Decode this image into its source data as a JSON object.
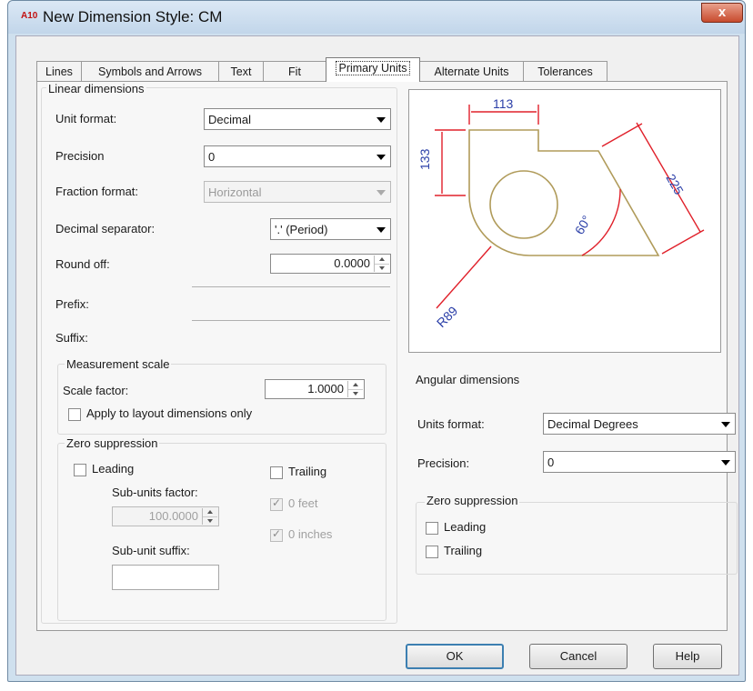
{
  "window": {
    "app_icon": "A10",
    "title": "New Dimension Style: CM",
    "close": "x"
  },
  "tabs": [
    {
      "label": "Lines"
    },
    {
      "label": "Symbols and Arrows"
    },
    {
      "label": "Text"
    },
    {
      "label": "Fit"
    },
    {
      "label": "Primary Units",
      "active": true
    },
    {
      "label": "Alternate Units"
    },
    {
      "label": "Tolerances"
    }
  ],
  "linear": {
    "heading": "Linear dimensions",
    "unit_format_label": "Unit format:",
    "unit_format_value": "Decimal",
    "precision_label": "Precision",
    "precision_value": "0",
    "fraction_format_label": "Fraction format:",
    "fraction_format_value": "Horizontal",
    "decimal_separator_label": "Decimal separator:",
    "decimal_separator_value": "'.' (Period)",
    "round_off_label": "Round off:",
    "round_off_value": "0.0000",
    "prefix_label": "Prefix:",
    "suffix_label": "Suffix:"
  },
  "measurement_scale": {
    "heading": "Measurement scale",
    "scale_factor_label": "Scale factor:",
    "scale_factor_value": "1.0000",
    "apply_layout_label": "Apply to layout dimensions only"
  },
  "zero_suppression_linear": {
    "heading": "Zero suppression",
    "leading_label": "Leading",
    "trailing_label": "Trailing",
    "sub_units_factor_label": "Sub-units factor:",
    "sub_units_factor_value": "100.0000",
    "zero_feet_label": "0 feet",
    "zero_inches_label": "0 inches",
    "sub_unit_suffix_label": "Sub-unit suffix:"
  },
  "preview": {
    "dim_top": "113",
    "dim_left": "133",
    "dim_right": "225",
    "dim_angle": "60°",
    "dim_radius": "R89",
    "line_color": "#b09b5a",
    "dim_color": "#e0202a",
    "text_color": "#2b3fa8"
  },
  "angular": {
    "heading": "Angular dimensions",
    "units_format_label": "Units format:",
    "units_format_value": "Decimal Degrees",
    "precision_label": "Precision:",
    "precision_value": "0",
    "zero_heading": "Zero suppression",
    "leading_label": "Leading",
    "trailing_label": "Trailing"
  },
  "buttons": {
    "ok": "OK",
    "cancel": "Cancel",
    "help": "Help"
  }
}
